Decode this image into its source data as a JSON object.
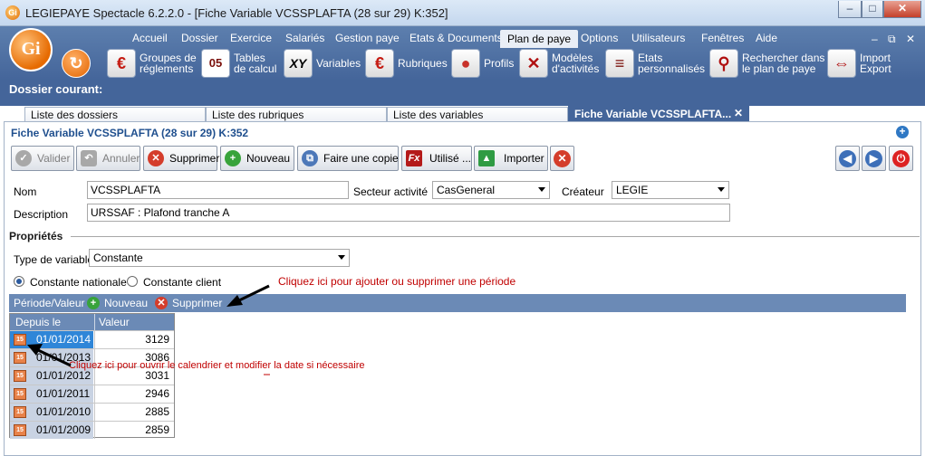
{
  "window": {
    "title": "LEGIEPAYE Spectacle 6.2.2.0 - [Fiche Variable VCSSPLAFTA (28 sur 29) K:352]",
    "app_icon": "Gi",
    "minimize": "–",
    "maximize": "□",
    "close": "✕"
  },
  "logo": "Gi",
  "menu": [
    "Accueil",
    "Dossier",
    "Exercice",
    "Salariés",
    "Gestion paye",
    "Etats & Documents",
    "Plan de paye",
    "Options",
    "Utilisateurs",
    "Fenêtres",
    "Aide"
  ],
  "mdi_controls": {
    "minimize": "–",
    "restore": "⧉",
    "close": "✕"
  },
  "toolbar": [
    {
      "label1": "",
      "label2": "",
      "icon": "refresh-icon",
      "glyph": "↻"
    },
    {
      "label1": "Groupes de",
      "label2": "réglements",
      "icon": "euro-icon",
      "glyph": "€"
    },
    {
      "label1": "Tables",
      "label2": "de calcul",
      "icon": "numbers-icon",
      "glyph": "05"
    },
    {
      "label1": "Variables",
      "label2": "",
      "icon": "xy-icon",
      "glyph": "XY"
    },
    {
      "label1": "Rubriques",
      "label2": "",
      "icon": "euro-icon",
      "glyph": "€"
    },
    {
      "label1": "Profils",
      "label2": "",
      "icon": "users-icon",
      "glyph": "●"
    },
    {
      "label1": "Modèles",
      "label2": "d'activités",
      "icon": "document-x-icon",
      "glyph": "✕"
    },
    {
      "label1": "Etats",
      "label2": "personnalisés",
      "icon": "report-icon",
      "glyph": "≡"
    },
    {
      "label1": "Rechercher dans",
      "label2": "le plan de paye",
      "icon": "search-icon",
      "glyph": "⚲"
    },
    {
      "label1": "Import",
      "label2": "Export",
      "icon": "import-export-icon",
      "glyph": "⇔"
    }
  ],
  "dossier": {
    "label": "Dossier courant:"
  },
  "tabs": [
    "Liste des dossiers",
    "Liste des rubriques",
    "Liste des variables",
    "Fiche Variable VCSSPLAFTA..."
  ],
  "tab_close": "✕",
  "fiche": {
    "title": "Fiche Variable VCSSPLAFTA (28 sur 29) K:352",
    "add_glyph": "+",
    "buttons": {
      "valider": "Valider",
      "annuler": "Annuler",
      "supprimer": "Supprimer",
      "nouveau": "Nouveau",
      "copie": "Faire une copie",
      "utilise": "Utilisé ...",
      "importer": "Importer"
    },
    "glyphs": {
      "check": "✓",
      "undo": "↶",
      "x": "✕",
      "plus": "+",
      "copy": "⧉",
      "fx": "Fx",
      "up": "▲",
      "left": "◀",
      "right": "▶",
      "power": "⏻"
    }
  },
  "form": {
    "nom_label": "Nom",
    "nom_value": "VCSSPLAFTA",
    "secteur_label": "Secteur activité",
    "secteur_value": "CasGeneral",
    "createur_label": "Créateur",
    "createur_value": "LEGIE",
    "description_label": "Description",
    "description_value": "URSSAF : Plafond tranche A"
  },
  "proprietes": {
    "title": "Propriétés",
    "type_label": "Type de variable",
    "type_value": "Constante",
    "radio_nationale": "Constante nationale",
    "radio_client": "Constante client",
    "selected": "Constante nationale"
  },
  "periode": {
    "label": "Période/Valeur",
    "nouveau": "Nouveau",
    "supprimer": "Supprimer",
    "col_depuis": "Depuis le",
    "col_valeur": "Valeur",
    "rows": [
      {
        "date": "01/01/2014",
        "value": "3129"
      },
      {
        "date": "01/01/2013",
        "value": "3086"
      },
      {
        "date": "01/01/2012",
        "value": "3031"
      },
      {
        "date": "01/01/2011",
        "value": "2946"
      },
      {
        "date": "01/01/2010",
        "value": "2885"
      },
      {
        "date": "01/01/2009",
        "value": "2859"
      }
    ],
    "calendar_glyph": "15"
  },
  "annotations": {
    "top": "Cliquez ici pour ajouter ou supprimer une période",
    "bottom": "Cliquez ici pour ouvrir le calendrier et modifier la date si nécessaire"
  }
}
